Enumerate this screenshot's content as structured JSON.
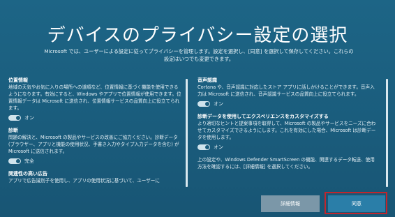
{
  "title": "デバイスのプライバシー設定の選択",
  "intro": "Microsoft では、ユーザーによる設定に従ってプライバシーを管理します。設定を選択し、[同意] を選択して保存してください。これらの設定はいつでも変更できます。",
  "left": {
    "location_title": "位置情報",
    "location_desc": "地域の天気やお気に入りの場所への道順など、位置情報に基づく機能を使用できるようになります。有効にすると、Windows やアプリで位置情報が使用できます。位置情報データは Microsoft に送信され、位置情報サービスの品質向上に役立てられます。",
    "location_state": "オン",
    "diagnostic_title": "診断",
    "diagnostic_desc": "問題の解決と、Microsoft の製品やサービスの改善にご協力ください。診断データ (ブラウザー、アプリと機能の使用状況、手書き入力やタイプ入力データを含む) が Microsoft に送信されます。",
    "diagnostic_state": "完全",
    "ads_title": "関連性の高い広告",
    "ads_desc": "アプリで広告識別子を使用し、アプリの使用状況に基づいて、ユーザーに"
  },
  "right": {
    "speech_title": "音声認識",
    "speech_desc": "Cortana や、音声認識に対応したストア アプリに話しかけることができます。音声入力は Microsoft に送信され、音声認識サービスの品質向上に役立てられます。",
    "speech_state": "オン",
    "tailored_title": "診断データを使用してエクスペリエンスをカスタマイズする",
    "tailored_desc": "より適切なヒントと提案事項を取得して、Microsoft の製品やサービスをニーズに合わせてカスタマイズできるようにします。これを有効にした場合、Microsoft は診断データを使用します。",
    "tailored_state": "オン",
    "smartscreen_desc": "上の設定や、Windows Defender SmartScreen の機能、関連するデータ転送、使用方法を確認するには、[詳細情報] を選択してください。"
  },
  "buttons": {
    "more_info": "詳細情報",
    "agree": "同意"
  },
  "colors": {
    "background": "#1b5f80",
    "highlight": "#c0262d"
  }
}
